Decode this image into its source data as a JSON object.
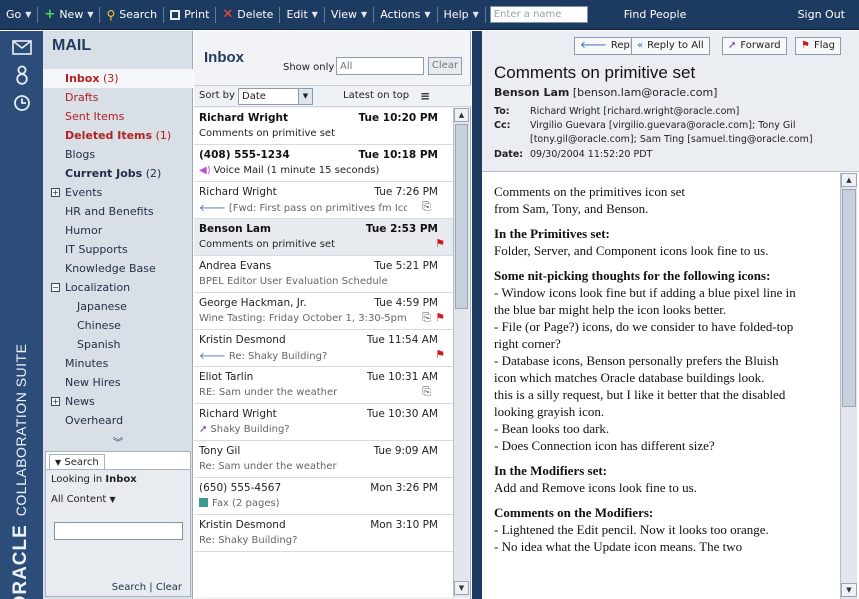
{
  "toolbar": {
    "go": "Go",
    "new": "New",
    "search": "Search",
    "print": "Print",
    "delete": "Delete",
    "edit": "Edit",
    "view": "View",
    "actions": "Actions",
    "help": "Help",
    "name_placeholder": "Enter a name",
    "find_people": "Find People",
    "sign_out": "Sign Out"
  },
  "brand": {
    "name": "ORACLE",
    "suite": "COLLABORATION SUITE"
  },
  "folders": {
    "title": "MAIL",
    "items": [
      {
        "label": "Inbox",
        "count": "(3)"
      },
      {
        "label": "Drafts",
        "count": ""
      },
      {
        "label": "Sent Items",
        "count": ""
      },
      {
        "label": "Deleted Items",
        "count": "(1)"
      },
      {
        "label": "Blogs",
        "count": ""
      },
      {
        "label": "Current Jobs",
        "count": "(2)"
      },
      {
        "label": "Events",
        "count": ""
      },
      {
        "label": "HR and Benefits",
        "count": ""
      },
      {
        "label": "Humor",
        "count": ""
      },
      {
        "label": "IT Supports",
        "count": ""
      },
      {
        "label": "Knowledge Base",
        "count": ""
      },
      {
        "label": "Localization",
        "count": ""
      },
      {
        "label": "Japanese",
        "count": ""
      },
      {
        "label": "Chinese",
        "count": ""
      },
      {
        "label": "Spanish",
        "count": ""
      },
      {
        "label": "Minutes",
        "count": ""
      },
      {
        "label": "New Hires",
        "count": ""
      },
      {
        "label": "News",
        "count": ""
      },
      {
        "label": "Overheard",
        "count": ""
      }
    ],
    "search": {
      "tab_label": "Search",
      "looking_in": "Looking in",
      "looking_in_folder": "Inbox",
      "scope": "All Content",
      "search_link": "Search",
      "separator": "|",
      "clear_link": "Clear"
    }
  },
  "inbox": {
    "title": "Inbox",
    "show_only_label": "Show only",
    "filter_placeholder": "All",
    "clear_button": "Clear",
    "sort_by_label": "Sort by",
    "sort_value": "Date",
    "latest_on_top": "Latest on top",
    "messages": [
      {
        "sender": "Richard Wright",
        "time": "Tue 10:20 PM",
        "subject": "Comments on primitive set"
      },
      {
        "sender": "(408) 555-1234",
        "time": "Tue 10:18 PM",
        "subject": "Voice Mail (1 minute 15 seconds)"
      },
      {
        "sender": "Richard Wright",
        "time": "Tue 7:26 PM",
        "subject": "[Fwd: First pass on primitives fm IconFa..."
      },
      {
        "sender": "Benson Lam",
        "time": "Tue 2:53 PM",
        "subject": "Comments on primitive set"
      },
      {
        "sender": "Andrea Evans",
        "time": "Tue 5:21 PM",
        "subject": "BPEL Editor User Evaluation Schedule"
      },
      {
        "sender": "George Hackman, Jr.",
        "time": "Tue 4:59 PM",
        "subject": "Wine Tasting: Friday October 1, 3:30-5pm"
      },
      {
        "sender": "Kristin Desmond",
        "time": "Tue 11:54 AM",
        "subject": "Re: Shaky Building?"
      },
      {
        "sender": "Eliot Tarlin",
        "time": "Tue 10:31 AM",
        "subject": "RE: Sam under the weather"
      },
      {
        "sender": "Richard Wright",
        "time": "Tue 10:30 AM",
        "subject": "Shaky Building?"
      },
      {
        "sender": "Tony Gil",
        "time": "Tue 9:09 AM",
        "subject": "Re: Sam under the weather"
      },
      {
        "sender": "(650) 555-4567",
        "time": "Mon 3:26 PM",
        "subject": "Fax (2 pages)"
      },
      {
        "sender": "Kristin Desmond",
        "time": "Mon 3:10 PM",
        "subject": "Re: Shaky Building?"
      }
    ]
  },
  "reader": {
    "reply": "Reply",
    "reply_all": "Reply to All",
    "forward": "Forward",
    "flag": "Flag",
    "subject": "Comments on primitive set",
    "from_name": "Benson Lam",
    "from_email": "[benson.lam@oracle.com]",
    "to_label": "To:",
    "to": "Richard Wright [richard.wright@oracle.com]",
    "cc_label": "Cc:",
    "cc_line1": "Virgilio Guevara [virgilio.guevara@oracle.com]; Tony Gil",
    "cc_line2": "[tony.gil@oracle.com]; Sam Ting [samuel.ting@oracle.com]",
    "date_label": "Date:",
    "date": "09/30/2004 11:52:20 PDT",
    "body": {
      "l1": "Comments on the primitives icon set",
      "l2": "from Sam, Tony, and Benson.",
      "h1": "In the Primitives set:",
      "l3": "Folder, Server, and Component  icons look fine to us.",
      "h2": "Some nit-picking thoughts for the following icons:",
      "l4": "- Window icons look fine but if adding a blue pixel line in",
      "l5": "the blue bar might help the icon looks better.",
      "l6": "- File (or Page?) icons, do we consider to have folded-top",
      "l7": "right corner?",
      "l8": "- Database icons,  Benson personally prefers the Bluish",
      "l9": "icon which matches Oracle database buildings look.",
      "l10": "this is a silly request, but I like it better that the disabled",
      "l11": "looking grayish icon.",
      "l12": "- Bean looks too dark.",
      "l13": "- Does Connection icon has different size?",
      "h3": "In the Modifiers set:",
      "l14": "Add and Remove icons look fine to us.",
      "h4": "Comments on the Modifiers:",
      "l15": "- Lightened the Edit pencil. Now it looks too orange.",
      "l16": "- No idea what the Update icon means. The two"
    }
  }
}
